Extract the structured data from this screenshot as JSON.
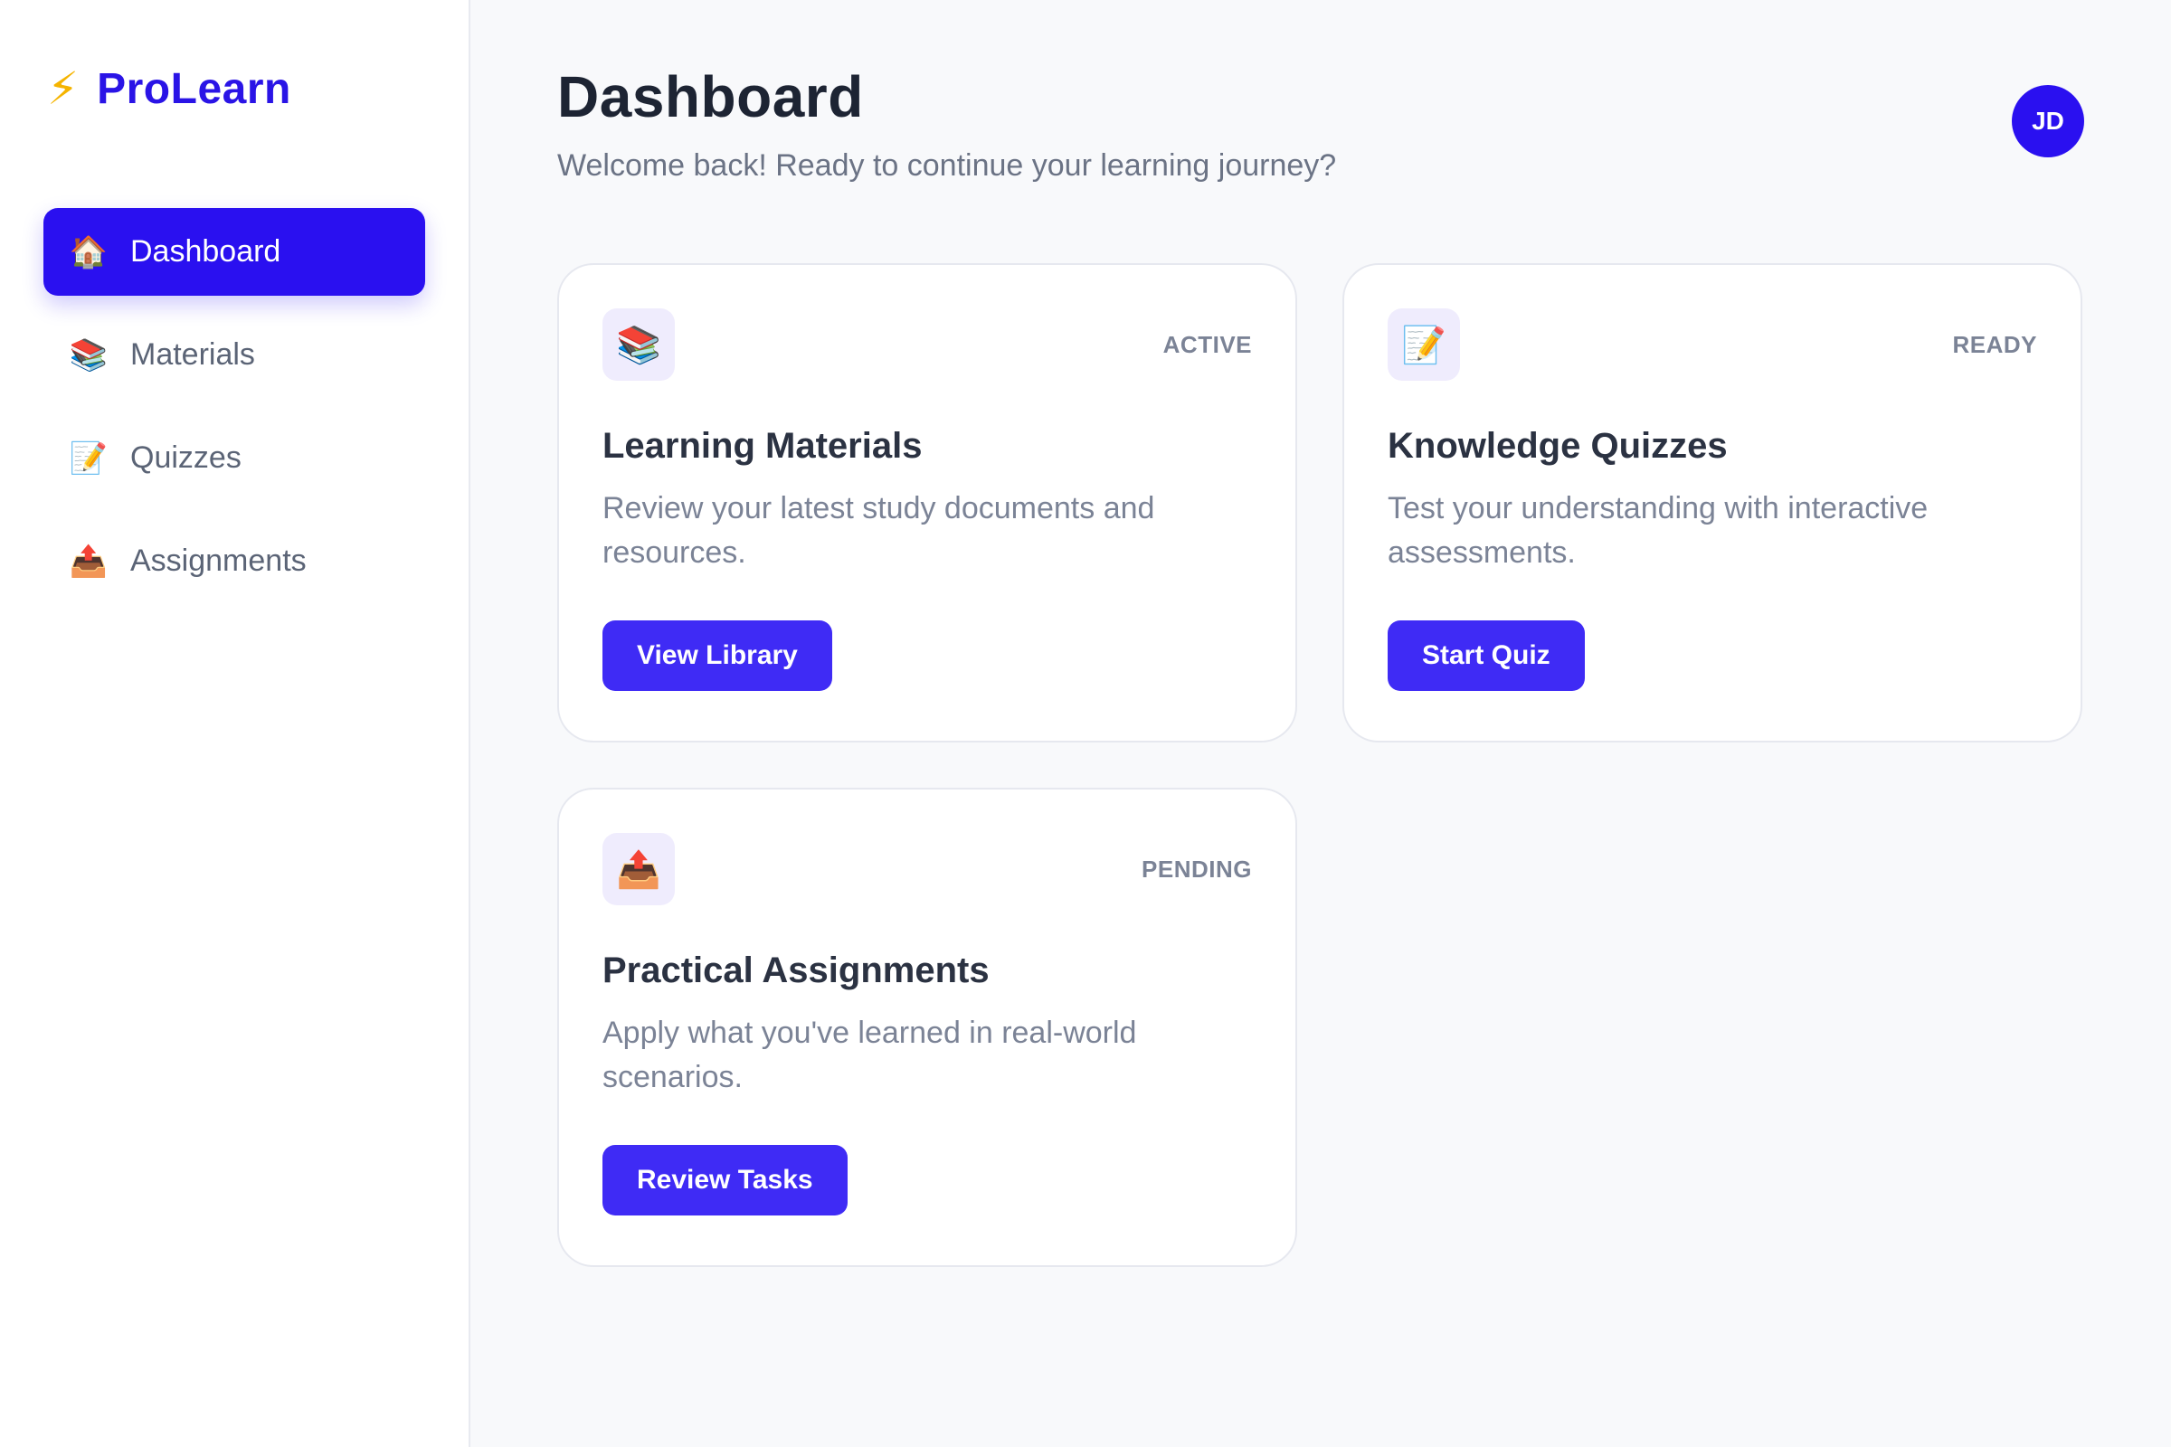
{
  "brand": {
    "icon": "lightning-bolt-icon",
    "name": "ProLearn"
  },
  "nav": {
    "items": [
      {
        "icon": "house-icon",
        "label": "Dashboard",
        "active": true
      },
      {
        "icon": "books-icon",
        "label": "Materials",
        "active": false
      },
      {
        "icon": "memo-icon",
        "label": "Quizzes",
        "active": false
      },
      {
        "icon": "outbox-tray-icon",
        "label": "Assignments",
        "active": false
      }
    ]
  },
  "header": {
    "title": "Dashboard",
    "subtitle": "Welcome back! Ready to continue your learning journey?",
    "avatar_initials": "JD"
  },
  "cards": [
    {
      "icon": "books-icon",
      "status": "ACTIVE",
      "title": "Learning Materials",
      "description": "Review your latest study documents and resources.",
      "button": "View Library"
    },
    {
      "icon": "memo-icon",
      "status": "READY",
      "title": "Knowledge Quizzes",
      "description": "Test your understanding with interactive assessments.",
      "button": "Start Quiz"
    },
    {
      "icon": "outbox-tray-icon",
      "status": "PENDING",
      "title": "Practical Assignments",
      "description": "Apply what you've learned in real-world scenarios.",
      "button": "Review Tasks"
    }
  ],
  "colors": {
    "accent": "#2a10f0",
    "button": "#3f2bf5",
    "brand_text": "#2a14e6",
    "bolt": "#f5b400"
  }
}
